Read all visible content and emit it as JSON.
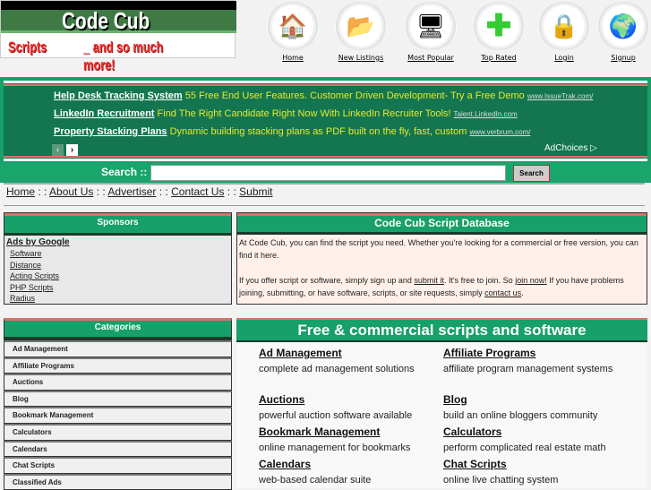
{
  "logo": {
    "title": "Code Cub",
    "sub": "Scripts",
    "sub2": "_  and so much more!"
  },
  "nav": [
    {
      "label": "Home",
      "icon": "house-icon"
    },
    {
      "label": "New Listings",
      "icon": "folder-icon"
    },
    {
      "label": "Most Popular",
      "icon": "monitor-icon"
    },
    {
      "label": "Top Rated",
      "icon": "plus-icon"
    },
    {
      "label": "Login",
      "icon": "lock-icon"
    },
    {
      "label": "Signup",
      "icon": "globe-icon"
    }
  ],
  "ads": [
    {
      "title": "Help Desk Tracking System",
      "text": "55 Free End User Features. Customer Driven Development- Try a Free Demo",
      "url": "www.IssueTrak.com/"
    },
    {
      "title": "LinkedIn Recruitment",
      "text": "Find The Right Candidate Right Now With LinkedIn Recruiter Tools!",
      "url": "Talent.LinkedIn.com"
    },
    {
      "title": "Property Stacking Plans",
      "text": "Dynamic building stacking plans as PDF built on the fly, fast, custom",
      "url": "www.verbrum.com/"
    }
  ],
  "adchoices": "AdChoices ▷",
  "search": {
    "label": "Search ::",
    "button": "Search",
    "value": ""
  },
  "links": [
    "Home",
    "About Us",
    "Advertiser",
    "Contact Us",
    "Submit"
  ],
  "sponsors": {
    "title": "Sponsors",
    "ads_label": "Ads by Google",
    "items": [
      "Software",
      "Distance",
      "Acting Scripts",
      "PHP Scripts",
      "Radius"
    ]
  },
  "db": {
    "title": "Code Cub Script Database",
    "p1": "At Code Cub, you can find the script you need. Whether you're looking for a commercial or free version, you can find it here.",
    "p2a": "If you offer script or software, simply sign up and ",
    "submit": "submit it",
    "p2b": ". It's free to join. So ",
    "join": "join now!",
    "p2c": " If you have problems joining, submitting, or have software, scripts, or site requests, simply ",
    "contact": "contact us",
    "p2d": "."
  },
  "categories": {
    "title": "Categories",
    "items": [
      "Ad Management",
      "Affiliate Programs",
      "Auctions",
      "Blog",
      "Bookmark Management",
      "Calculators",
      "Calendars",
      "Chat Scripts",
      "Classified Ads"
    ]
  },
  "free": {
    "title": "Free & commercial scripts and software",
    "items": [
      {
        "name": "Ad Management",
        "desc": "complete ad management solutions"
      },
      {
        "name": "Affiliate Programs",
        "desc": "affiliate program management systems"
      },
      {
        "name": "Auctions",
        "desc": "powerful auction software available"
      },
      {
        "name": "Blog",
        "desc": "build an online bloggers community"
      },
      {
        "name": "Bookmark Management",
        "desc": "online management for bookmarks"
      },
      {
        "name": "Calculators",
        "desc": "perform complicated real estate math"
      },
      {
        "name": "Calendars",
        "desc": "web-based calendar suite"
      },
      {
        "name": "Chat Scripts",
        "desc": "online live chatting system"
      }
    ]
  }
}
